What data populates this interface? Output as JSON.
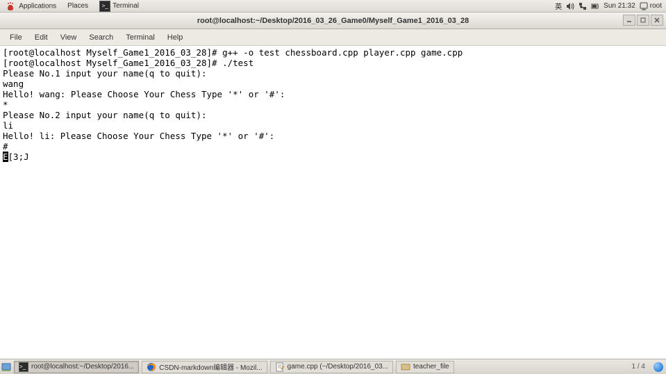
{
  "top_panel": {
    "applications": "Applications",
    "places": "Places",
    "terminal_task": "Terminal",
    "ime": "英",
    "clock": "Sun 21:32",
    "user": "root"
  },
  "window": {
    "title": "root@localhost:~/Desktop/2016_03_26_Game0/Myself_Game1_2016_03_28"
  },
  "menubar": {
    "file": "File",
    "edit": "Edit",
    "view": "View",
    "search": "Search",
    "terminal": "Terminal",
    "help": "Help"
  },
  "terminal": {
    "lines": [
      "[root@localhost Myself_Game1_2016_03_28]# g++ -o test chessboard.cpp player.cpp game.cpp",
      "[root@localhost Myself_Game1_2016_03_28]# ./test",
      "Please No.1 input your name(q to quit):",
      "wang",
      "Hello! wang: Please Choose Your Chess Type '*' or '#':",
      "*",
      "Please No.2 input your name(q to quit):",
      "li",
      "Hello! li: Please Choose Your Chess Type '*' or '#':",
      "#"
    ],
    "last_inv": "E",
    "last_tail": "[3;J"
  },
  "taskbar": {
    "task1": "root@localhost:~/Desktop/2016...",
    "task2": "CSDN-markdown编辑器 - Mozil...",
    "task3": "game.cpp (~/Desktop/2016_03...",
    "task4": "teacher_file",
    "ws": "1 / 4"
  }
}
